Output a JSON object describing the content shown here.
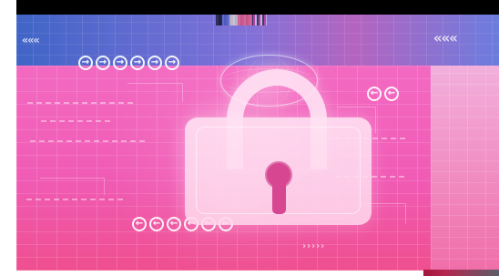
{
  "scene": {
    "subject": "padlock-cybersecurity-background",
    "colors": {
      "deep_blue": "#365cc4",
      "purple": "#7665d5",
      "pink": "#f36ac2",
      "hot_pink": "#ef4f8f",
      "soft_white": "#ffe5f5",
      "dark_red": "#a3153a"
    }
  },
  "icons": {
    "top_row": [
      "circle-arrow-icon",
      "circle-arrow-icon",
      "circle-arrow-icon",
      "circle-arrow-icon",
      "circle-arrow-icon",
      "circle-arrow-icon"
    ],
    "bottom_row": [
      "circle-arrow-icon",
      "circle-arrow-icon",
      "circle-arrow-icon",
      "circle-arrow-icon",
      "circle-arrow-icon",
      "circle-arrow-icon"
    ],
    "right_row": [
      "circle-arrow-icon",
      "circle-arrow-icon"
    ]
  }
}
